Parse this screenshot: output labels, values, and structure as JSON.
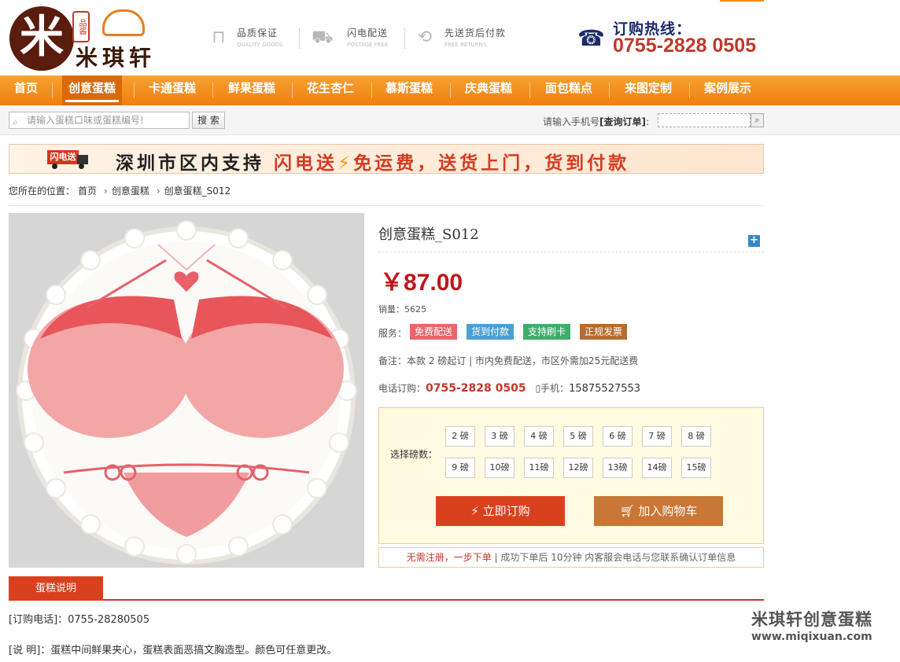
{
  "brand": {
    "seal_text": "品酱",
    "logo_mark": "米",
    "name": "米琪轩"
  },
  "features": [
    {
      "icon": "bookmark-icon",
      "glyph": "⊓",
      "title": "品质保证",
      "subtitle": "QUALITY GOODS"
    },
    {
      "icon": "truck-icon",
      "glyph": "⛟",
      "title": "闪电配送",
      "subtitle": "POSTAGE FREE"
    },
    {
      "icon": "return-icon",
      "glyph": "⟲",
      "title": "先送货后付款",
      "subtitle": "FREE RETURNS"
    }
  ],
  "hotline": {
    "title": "订购热线：",
    "number": "0755-2828 0505"
  },
  "nav": [
    "首页",
    "创意蛋糕",
    "卡通蛋糕",
    "鲜果蛋糕",
    "花生杏仁",
    "慕斯蛋糕",
    "庆典蛋糕",
    "面包糕点",
    "来图定制",
    "案例展示"
  ],
  "search": {
    "placeholder": "请输入蛋糕口味或蛋糕编号!",
    "button": "搜 索",
    "order_prompt": "请输入手机号",
    "order_link": "[查询订单]",
    "order_colon": ":"
  },
  "banner": {
    "truck_label": "闪电送",
    "text_start": "深圳市区内支持",
    "text_highlight": "闪电送",
    "bolt": "⚡",
    "text_end": "免运费，送货上门，货到付款"
  },
  "breadcrumb": {
    "prefix": "您所在的位置：",
    "items": [
      "首页",
      "创意蛋糕",
      "创意蛋糕_S012"
    ]
  },
  "product": {
    "title": "创意蛋糕_S012",
    "price": "￥87.00",
    "sales_label": "销量：",
    "sales_value": "5625",
    "service_label": "服务：",
    "services": [
      {
        "label": "免费配送",
        "color": "#e8676b"
      },
      {
        "label": "货到付款",
        "color": "#4c9fd3"
      },
      {
        "label": "支持刷卡",
        "color": "#3fae6b"
      },
      {
        "label": "正规发票",
        "color": "#b86b2f"
      }
    ],
    "remark": "备注：本款 2 磅起订 | 市内免费配送，市区外需加25元配送费",
    "tel_label": "电话订购：",
    "tel_number": "0755-2828 0505",
    "mobile_label": "手机：",
    "mobile_number": "15875527553"
  },
  "order_box": {
    "select_label": "选择磅数：",
    "sizes": [
      "2 磅",
      "3 磅",
      "4 磅",
      "5 磅",
      "6 磅",
      "7 磅",
      "8 磅",
      "9 磅",
      "10磅",
      "11磅",
      "12磅",
      "13磅",
      "14磅",
      "15磅"
    ],
    "buy_label": "立即订购",
    "cart_label": "加入购物车"
  },
  "notice": {
    "emphasis": "无需注册，一步下单",
    "rest": " | 成功下单后 10分钟 内客服会电话与您联系确认订单信息"
  },
  "description": {
    "tab": "蛋糕说明",
    "line1": "[订购电话]：0755-28280505",
    "line2": "[说 明]：蛋糕中间鲜果夹心，蛋糕表面恶搞文胸造型。颜色可任意更改。"
  },
  "watermark": {
    "line1": "米琪轩创意蛋糕",
    "line2": "www.miqixuan.com"
  }
}
